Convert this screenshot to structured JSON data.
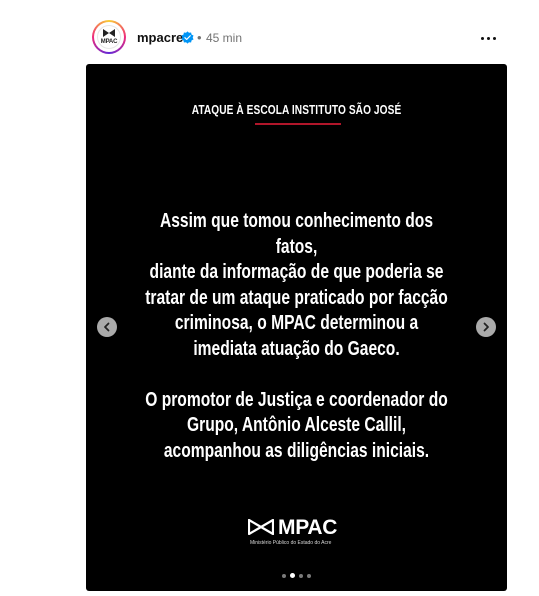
{
  "header": {
    "username": "mpacre",
    "separator": "•",
    "time": "45 min",
    "avatar_label": "MPAC"
  },
  "slide": {
    "title": "ATAQUE À ESCOLA INSTITUTO SÃO JOSÉ",
    "paragraph1": [
      "Assim que tomou conhecimento dos fatos,",
      "diante da informação de que poderia se",
      "tratar de um ataque praticado por facção",
      "criminosa, o MPAC determinou a",
      "imediata atuação do Gaeco."
    ],
    "paragraph2": [
      "O promotor de Justiça e coordenador do",
      "Grupo, Antônio Alceste Callil,",
      "acompanhou as diligências iniciais."
    ],
    "brand_name": "MPAC",
    "brand_subtitle": "Ministério Público do Estado do Acre",
    "accent_color": "#b0162a"
  },
  "carousel": {
    "current_index": 1,
    "total": 4
  },
  "icons": {
    "verified": "verified-badge-icon",
    "more": "more-options-icon",
    "prev": "chevron-left-icon",
    "next": "chevron-right-icon"
  }
}
